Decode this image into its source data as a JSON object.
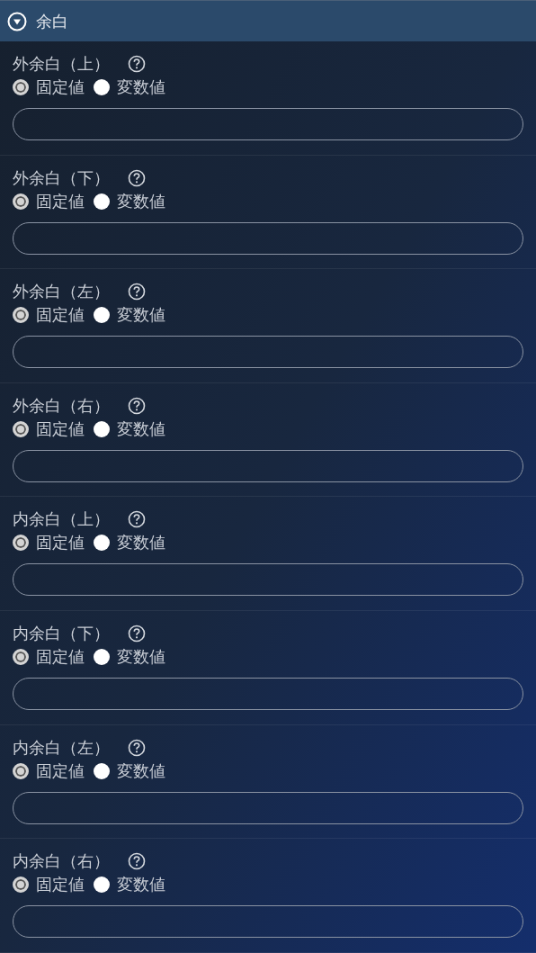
{
  "panel": {
    "title": "余白",
    "expanded": true
  },
  "fields": [
    {
      "label": "外余白（上）",
      "options": [
        {
          "label": "固定値",
          "selected": true
        },
        {
          "label": "変数値",
          "selected": false
        }
      ]
    },
    {
      "label": "外余白（下）",
      "options": [
        {
          "label": "固定値",
          "selected": true
        },
        {
          "label": "変数値",
          "selected": false
        }
      ]
    },
    {
      "label": "外余白（左）",
      "options": [
        {
          "label": "固定値",
          "selected": true
        },
        {
          "label": "変数値",
          "selected": false
        }
      ]
    },
    {
      "label": "外余白（右）",
      "options": [
        {
          "label": "固定値",
          "selected": true
        },
        {
          "label": "変数値",
          "selected": false
        }
      ]
    },
    {
      "label": "内余白（上）",
      "options": [
        {
          "label": "固定値",
          "selected": true
        },
        {
          "label": "変数値",
          "selected": false
        }
      ]
    },
    {
      "label": "内余白（下）",
      "options": [
        {
          "label": "固定値",
          "selected": true
        },
        {
          "label": "変数値",
          "selected": false
        }
      ]
    },
    {
      "label": "内余白（左）",
      "options": [
        {
          "label": "固定値",
          "selected": true
        },
        {
          "label": "変数値",
          "selected": false
        }
      ]
    },
    {
      "label": "内余白（右）",
      "options": [
        {
          "label": "固定値",
          "selected": true
        },
        {
          "label": "変数値",
          "selected": false
        }
      ]
    }
  ]
}
